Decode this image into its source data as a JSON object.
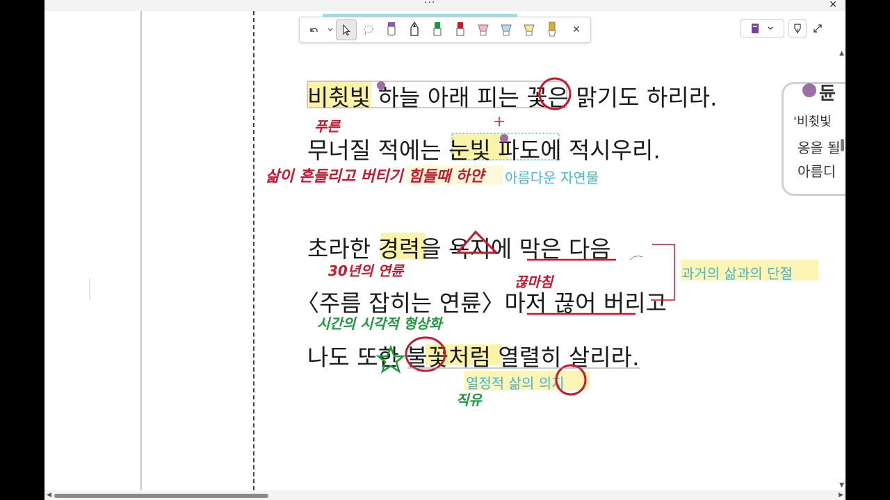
{
  "window": {
    "more_label": "···",
    "close_label": "✕"
  },
  "toolbar": {
    "tools": [
      {
        "name": "undo-icon"
      },
      {
        "name": "lasso-icon"
      },
      {
        "name": "pen-purple-icon",
        "color": "#8e5aa8"
      },
      {
        "name": "pen-black-icon",
        "color": "#222222"
      },
      {
        "name": "pen-green-icon",
        "color": "#1a9a3a"
      },
      {
        "name": "pen-red-icon",
        "color": "#d0142c"
      },
      {
        "name": "highlighter-pink-icon",
        "color": "#f4b9d0"
      },
      {
        "name": "highlighter-blue-icon",
        "color": "#b9d9f4"
      },
      {
        "name": "highlighter-yellow-icon",
        "color": "#f4ee8a"
      },
      {
        "name": "highlighter-gold-icon",
        "color": "#e0b020"
      }
    ],
    "close_label": "✕"
  },
  "poem": {
    "line1": "비췻빛 하늘 아래 피는 꽃은 맑기도 하리라.",
    "line2": "무너질 적에는 눈빛 파도에 적시우리.",
    "line3": "초라한 경력을 욕지에 막은 다음",
    "line4": "〈주름 잡히는 연륜〉마저 끊어 버리고",
    "line5": "나도 또한 불꽃처럼 열렬히 살리라."
  },
  "typed_notes": {
    "nature": "아름다운 자연물",
    "disconnect": "과거의 삶과의 단절",
    "passion": "열정적 삶의 의지"
  },
  "handwriting": {
    "blue": "푸른",
    "life_shaken": "삶이 흔들리고 버티기 힘들때 하얀",
    "years": "30년의 연륜",
    "cut_off": "끊마침",
    "visualize": "시간의 시각적 형상화",
    "simile": "직유"
  },
  "side_panel": {
    "title": "듄",
    "line1": "'비췻빛",
    "line2": "옹을 될",
    "line3": "아름디"
  },
  "colors": {
    "red_ink": "#d0142c",
    "green_ink": "#1a9a3a",
    "yellow_highlight": "#fbf3a8",
    "cyan_text": "#3fb8d8",
    "dot_purple": "#9b6fa3"
  }
}
